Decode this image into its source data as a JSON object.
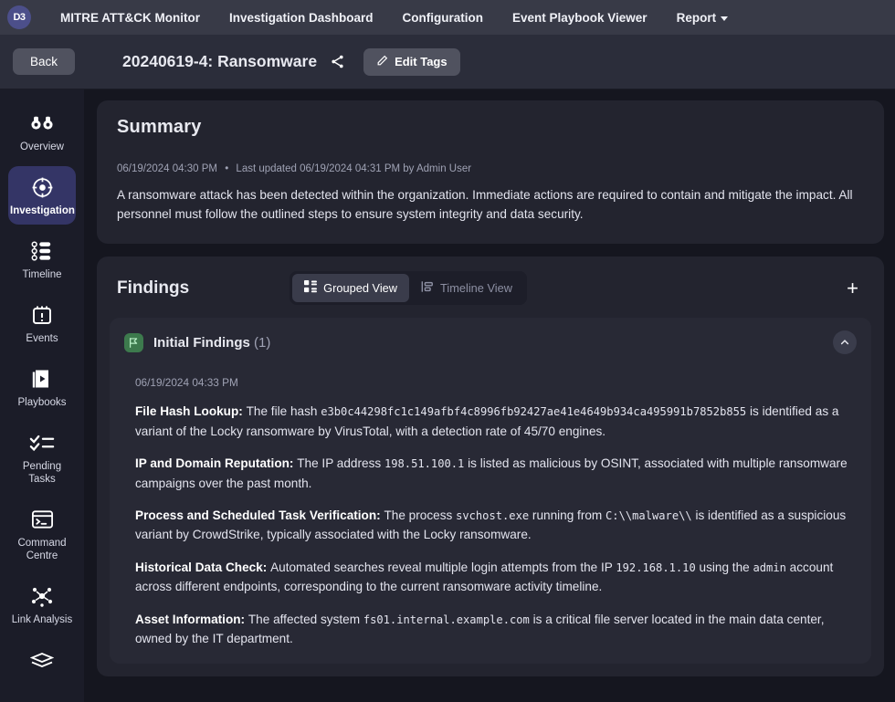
{
  "topnav": {
    "logo": "D3",
    "items": [
      {
        "label": "MITRE ATT&CK Monitor",
        "icon": ""
      },
      {
        "label": "Investigation Dashboard",
        "icon": ""
      },
      {
        "label": "Configuration",
        "icon": ""
      },
      {
        "label": "Event Playbook Viewer",
        "icon": ""
      },
      {
        "label": "Report",
        "icon": "chevron-down-icon"
      }
    ]
  },
  "subheader": {
    "back_label": "Back",
    "case_title": "20240619-4: Ransomware",
    "share_icon": "share-icon",
    "edit_tags_label": "Edit Tags",
    "edit_icon": "pencil-icon"
  },
  "sidebar": {
    "items": [
      {
        "label": "Overview",
        "icon": "binoculars-icon",
        "active": false
      },
      {
        "label": "Investigation",
        "icon": "target-icon",
        "active": true
      },
      {
        "label": "Timeline",
        "icon": "timeline-icon",
        "active": false
      },
      {
        "label": "Events",
        "icon": "calendar-alert-icon",
        "active": false
      },
      {
        "label": "Playbooks",
        "icon": "playbook-icon",
        "active": false
      },
      {
        "label": "Pending Tasks",
        "icon": "checklist-icon",
        "active": false
      },
      {
        "label": "Command Centre",
        "icon": "terminal-icon",
        "active": false
      },
      {
        "label": "Link Analysis",
        "icon": "network-nodes-icon",
        "active": false
      },
      {
        "label": "",
        "icon": "layers-icon",
        "active": false
      }
    ]
  },
  "summary": {
    "title": "Summary",
    "created": "06/19/2024 04:30 PM",
    "separator": "•",
    "updated": "Last updated 06/19/2024 04:31 PM by Admin User",
    "text": "A ransomware attack has been detected within the organization. Immediate actions are required to contain and mitigate the impact. All personnel must follow the outlined steps to ensure system integrity and data security."
  },
  "findings": {
    "title": "Findings",
    "views": [
      {
        "label": "Grouped View",
        "icon": "grid-icon",
        "active": true
      },
      {
        "label": "Timeline View",
        "icon": "timeline-view-icon",
        "active": false
      }
    ],
    "add_label": "+",
    "group": {
      "icon": "flag-icon",
      "title": "Initial Findings",
      "count": "(1)",
      "collapse_icon": "chevron-up-icon",
      "timestamp": "06/19/2024 04:33 PM",
      "entries": [
        {
          "label": "File Hash Lookup:",
          "parts": [
            {
              "t": "The file hash ",
              "mono": false
            },
            {
              "t": "e3b0c44298fc1c149afbf4c8996fb92427ae41e4649b934ca495991b7852b855",
              "mono": true
            },
            {
              "t": " is identified as a variant of the Locky ransomware by VirusTotal, with a detection rate of 45/70 engines.",
              "mono": false
            }
          ]
        },
        {
          "label": "IP and Domain Reputation:",
          "parts": [
            {
              "t": "The IP address ",
              "mono": false
            },
            {
              "t": "198.51.100.1",
              "mono": true
            },
            {
              "t": " is listed as malicious by OSINT, associated with multiple ransomware campaigns over the past month.",
              "mono": false
            }
          ]
        },
        {
          "label": "Process and Scheduled Task Verification:",
          "parts": [
            {
              "t": "The process ",
              "mono": false
            },
            {
              "t": "svchost.exe",
              "mono": true
            },
            {
              "t": " running from ",
              "mono": false
            },
            {
              "t": "C:\\\\malware\\\\",
              "mono": true
            },
            {
              "t": " is identified as a suspicious variant by CrowdStrike, typically associated with the Locky ransomware.",
              "mono": false
            }
          ]
        },
        {
          "label": "Historical Data Check:",
          "parts": [
            {
              "t": "Automated searches reveal multiple login attempts from the IP ",
              "mono": false
            },
            {
              "t": "192.168.1.10",
              "mono": true
            },
            {
              "t": " using the ",
              "mono": false
            },
            {
              "t": "admin",
              "mono": true
            },
            {
              "t": " account across different endpoints, corresponding to the current ransomware activity timeline.",
              "mono": false
            }
          ]
        },
        {
          "label": "Asset Information:",
          "parts": [
            {
              "t": "The affected system ",
              "mono": false
            },
            {
              "t": "fs01.internal.example.com",
              "mono": true
            },
            {
              "t": " is a critical file server located in the main data center, owned by the IT department.",
              "mono": false
            }
          ]
        }
      ]
    }
  },
  "colors": {
    "accent_active": "#343566",
    "logo_bg": "#4c4f8a",
    "flag_green": "#3d7a4d",
    "page_bg": "#15161f",
    "card_bg": "#23242f"
  }
}
